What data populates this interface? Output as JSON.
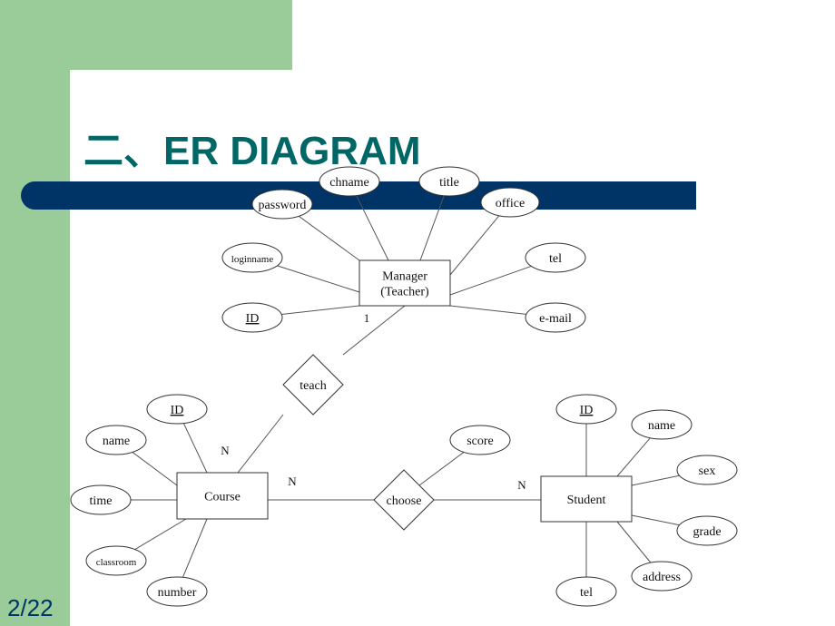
{
  "slide": {
    "title": "二、ER DIAGRAM",
    "page_number": "2/22",
    "colors": {
      "sidebar_green": "#99cc99",
      "title_teal": "#006666",
      "bar_navy": "#003366"
    }
  },
  "diagram": {
    "entities": [
      {
        "id": "manager",
        "label_lines": [
          "Manager",
          "(Teacher)"
        ]
      },
      {
        "id": "course",
        "label_lines": [
          "Course"
        ]
      },
      {
        "id": "student",
        "label_lines": [
          "Student"
        ]
      }
    ],
    "relationships": [
      {
        "id": "teach",
        "label": "teach",
        "connects": [
          "manager",
          "course"
        ],
        "cardinality": [
          "1",
          "N"
        ]
      },
      {
        "id": "choose",
        "label": "choose",
        "connects": [
          "course",
          "student"
        ],
        "cardinality": [
          "N",
          "N"
        ]
      }
    ],
    "attributes": {
      "manager": [
        {
          "label": "password",
          "key": false
        },
        {
          "label": "chname",
          "key": false
        },
        {
          "label": "title",
          "key": false
        },
        {
          "label": "office",
          "key": false
        },
        {
          "label": "loginname",
          "key": false
        },
        {
          "label": "tel",
          "key": false
        },
        {
          "label": "ID",
          "key": true
        },
        {
          "label": "e-mail",
          "key": false
        }
      ],
      "course": [
        {
          "label": "ID",
          "key": true
        },
        {
          "label": "name",
          "key": false
        },
        {
          "label": "time",
          "key": false
        },
        {
          "label": "classroom",
          "key": false
        },
        {
          "label": "number",
          "key": false
        }
      ],
      "student": [
        {
          "label": "ID",
          "key": true
        },
        {
          "label": "name",
          "key": false
        },
        {
          "label": "sex",
          "key": false
        },
        {
          "label": "grade",
          "key": false
        },
        {
          "label": "address",
          "key": false
        },
        {
          "label": "tel",
          "key": false
        }
      ],
      "choose": [
        {
          "label": "score",
          "key": false
        }
      ]
    }
  }
}
